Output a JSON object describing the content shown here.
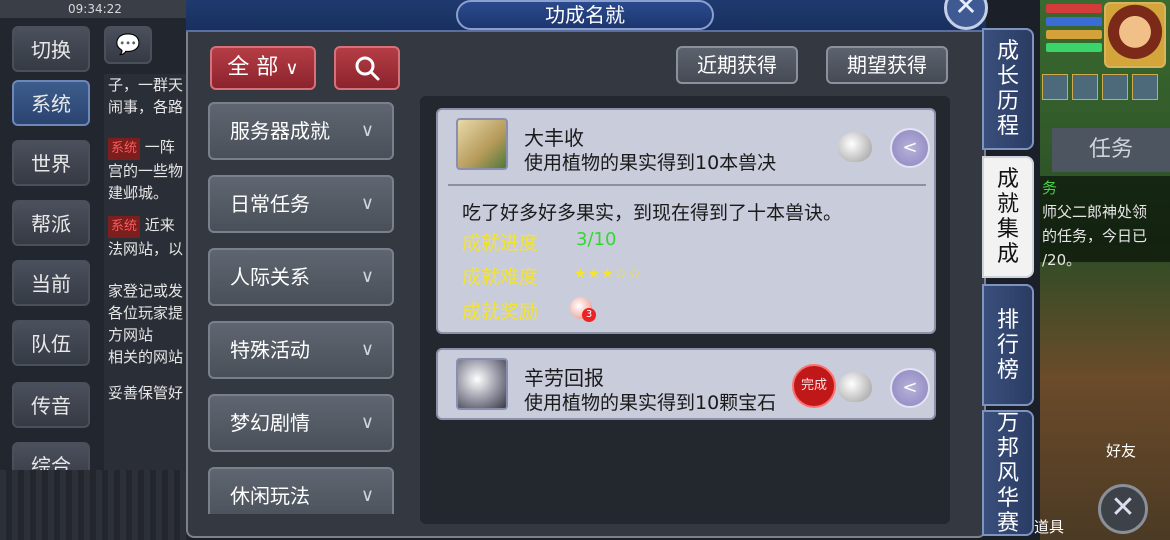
{
  "background": {
    "time_text": "09:34:22",
    "chat_channels": [
      "切换",
      "系统",
      "世界",
      "帮派",
      "当前",
      "队伍",
      "传音",
      "综合"
    ],
    "chat_icon_glyph": "💬",
    "chat_lines": [
      "子，一群天",
      "闹事，各路",
      "系统 一阵",
      "宫的一些物",
      "建邺城。",
      "系统 近来",
      "法网站，以",
      "家登记或发",
      "各位玩家提",
      "方网站",
      "相关的网站",
      "妥善保管好"
    ],
    "task_tab": "任务",
    "task_text": [
      "务",
      "师父二郎神处领",
      "的任务，今日已",
      "/20。"
    ],
    "friend_label": "好友",
    "item_label": "道具",
    "close_glyph": "✕"
  },
  "panel": {
    "title": "功成名就",
    "close_glyph": "✕",
    "filter_label": "全 部",
    "filter_chevron": "∨",
    "search_icon": "search-icon",
    "recent_button": "近期获得",
    "expected_button": "期望获得"
  },
  "categories": [
    {
      "label": "服务器成就"
    },
    {
      "label": "日常任务"
    },
    {
      "label": "人际关系"
    },
    {
      "label": "特殊活动"
    },
    {
      "label": "梦幻剧情"
    },
    {
      "label": "休闲玩法"
    }
  ],
  "achievements": [
    {
      "name": "大丰收",
      "desc": "使用植物的果实得到10本兽决",
      "detail": "吃了好多好多果实，到现在得到了十本兽诀。",
      "progress_label": "成就进度",
      "progress_value": "3/10",
      "difficulty_label": "成就难度",
      "difficulty_stars": "★★★☆☆",
      "reward_label": "成就奖励",
      "reward_count": "3"
    },
    {
      "name": "辛劳回报",
      "desc": "使用植物的果实得到10颗宝石",
      "stamp_text": "完成"
    }
  ],
  "side_tabs": [
    {
      "label": "成长历程"
    },
    {
      "label": "成就集成"
    },
    {
      "label": "排行榜"
    },
    {
      "label": "万邦风华赛"
    }
  ],
  "colors": {
    "accent_blue": "#1f3a6e",
    "red_button": "#b53d45",
    "progress_green": "#32d832",
    "label_yellow": "#f4e42a",
    "card_bg": "#c9ccdb"
  }
}
